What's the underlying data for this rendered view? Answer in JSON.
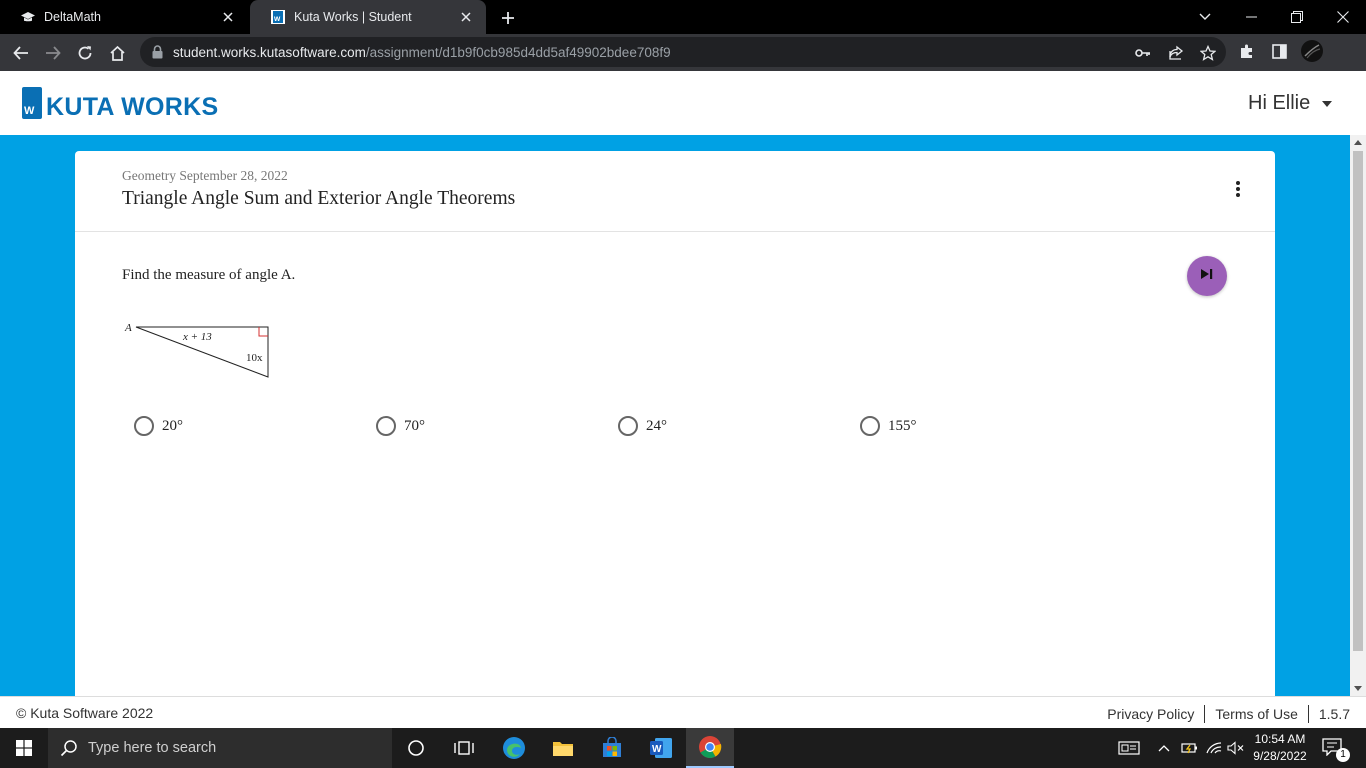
{
  "browser": {
    "tabs": [
      {
        "title": "DeltaMath",
        "icon": "graduation-cap-icon"
      },
      {
        "title": "Kuta Works | Student",
        "icon": "kuta-works-favicon"
      }
    ],
    "url_host": "student.works.kutasoftware.com",
    "url_path": "/assignment/d1b9f0cb985d4dd5af49902bdee708f9"
  },
  "header": {
    "logo_text": "KUTA WORKS",
    "logo_mark": "W",
    "user_greeting": "Hi Ellie",
    "brand_color": "#0a6fb4"
  },
  "assignment": {
    "subject": "Geometry",
    "date": "September 28, 2022",
    "title": "Triangle Angle Sum and Exterior Angle Theorems"
  },
  "question": {
    "prompt": "Find the measure of angle A.",
    "figure": {
      "vertex_label": "A",
      "side_label": "x + 13",
      "angle_label": "10x"
    },
    "choices": [
      "20°",
      "70°",
      "24°",
      "155°"
    ]
  },
  "footer": {
    "copyright": "© Kuta Software 2022",
    "links": [
      "Privacy Policy",
      "Terms of Use"
    ],
    "version": "1.5.7"
  },
  "taskbar": {
    "search_placeholder": "Type here to search",
    "time": "10:54 AM",
    "date": "9/28/2022",
    "notification_count": "1"
  },
  "colors": {
    "page_background": "#00a1e4",
    "skip_button": "#9b5fb8"
  }
}
